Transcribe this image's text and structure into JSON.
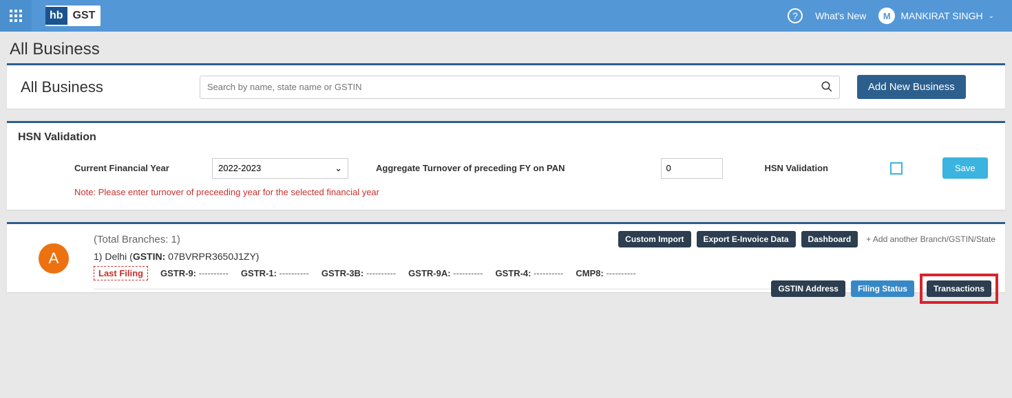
{
  "topbar": {
    "logo_hb": "hb",
    "logo_gst": "GST",
    "whats_new": "What's New",
    "user_initial": "M",
    "user_name": "MANKIRAT SINGH"
  },
  "page_title": "All Business",
  "search_panel": {
    "title": "All Business",
    "search_placeholder": "Search by name, state name or GSTIN",
    "add_button": "Add New Business"
  },
  "hsn": {
    "title": "HSN Validation",
    "fy_label": "Current Financial Year",
    "fy_value": "2022-2023",
    "turnover_label": "Aggregate Turnover of preceding FY on PAN",
    "turnover_value": "0",
    "validation_label": "HSN Validation",
    "save_label": "Save",
    "note": "Note: Please enter turnover of preceeding year for the selected financial year"
  },
  "business": {
    "avatar_letter": "A",
    "branches_title": "(Total Branches: 1)",
    "top_actions": {
      "custom_import": "Custom Import",
      "export_einvoice": "Export E-Invoice Data",
      "dashboard": "Dashboard",
      "add_branch": "+ Add another Branch/GSTIN/State"
    },
    "branch": {
      "index": "1)",
      "state": "Delhi",
      "gstin_label": "GSTIN:",
      "gstin": "07BVRPR3650J1ZY",
      "last_filing": "Last Filing",
      "returns": [
        {
          "label": "GSTR-9:",
          "value": "----------"
        },
        {
          "label": "GSTR-1:",
          "value": "----------"
        },
        {
          "label": "GSTR-3B:",
          "value": "----------"
        },
        {
          "label": "GSTR-9A:",
          "value": "----------"
        },
        {
          "label": "GSTR-4:",
          "value": "----------"
        },
        {
          "label": "CMP8:",
          "value": "----------"
        }
      ],
      "actions": {
        "gstin_address": "GSTIN Address",
        "filing_status": "Filing Status",
        "transactions": "Transactions"
      }
    }
  }
}
